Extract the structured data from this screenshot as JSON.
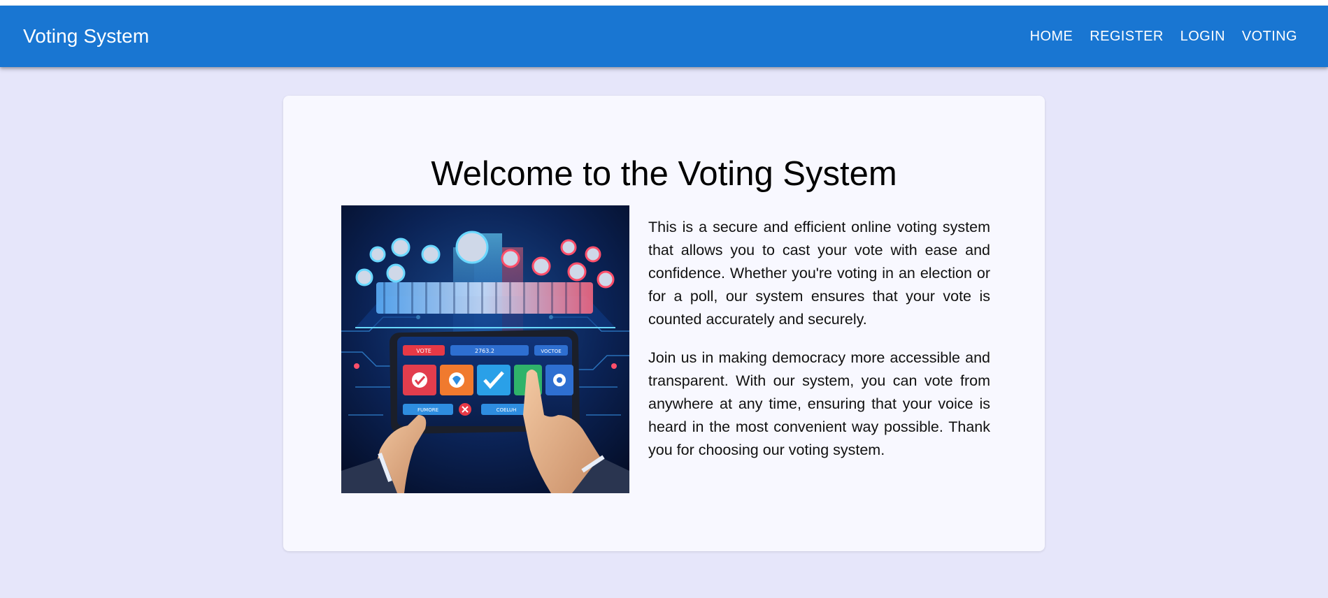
{
  "app": {
    "title": "Voting System"
  },
  "nav": {
    "items": [
      {
        "label": "HOME"
      },
      {
        "label": "REGISTER"
      },
      {
        "label": "LOGIN"
      },
      {
        "label": "VOTING"
      }
    ]
  },
  "main": {
    "heading": "Welcome to the Voting System",
    "paragraphs": [
      "This is a secure and efficient online voting system that allows you to cast your vote with ease and confidence. Whether you're voting in an election or for a poll, our system ensures that your vote is counted accurately and securely.",
      "Join us in making democracy more accessible and transparent. With our system, you can vote from anywhere at any time, ensuring that your voice is heard in the most convenient way possible. Thank you for choosing our voting system."
    ],
    "hero_image": {
      "buttons": [
        "VOTE",
        "VOCTOE",
        "FUMORE",
        "COELUH"
      ],
      "counter": "2763.2"
    }
  },
  "colors": {
    "appbar": "#1976d2",
    "background": "#e6e6fa",
    "card": "#f8f8ff"
  }
}
